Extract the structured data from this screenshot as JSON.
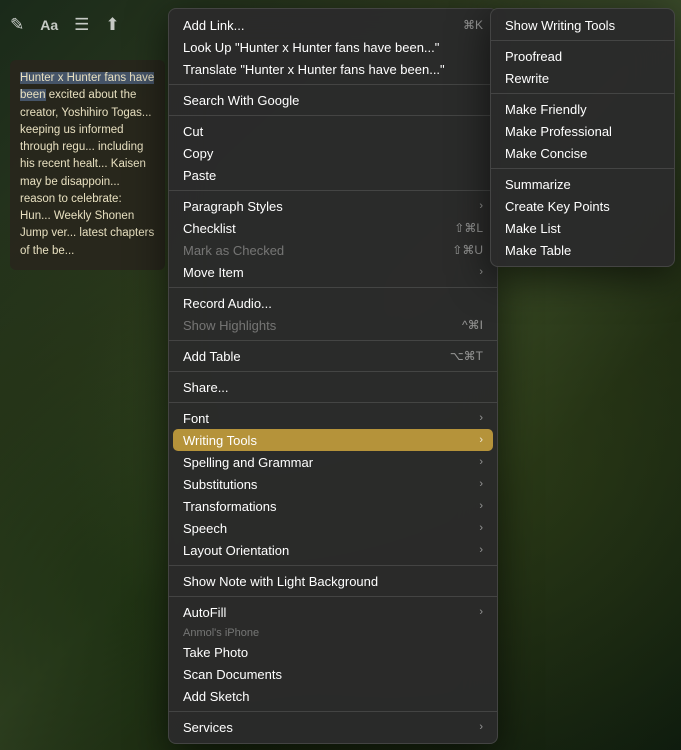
{
  "toolbar": {
    "icons": [
      "compose",
      "font",
      "list",
      "share"
    ]
  },
  "note": {
    "content": "Hunter x Hunter fans have been excited about the creator, Yoshihiro Togashi, keeping us informed through regular updates, including his recent health update. Kaisen may be disappoint... reason to celebrate: Hun... Weekly Shonen Jump ver... latest chapters of the be..."
  },
  "context_menu": {
    "items": [
      {
        "id": "add-link",
        "label": "Add Link...",
        "shortcut": "⌘K",
        "arrow": false,
        "disabled": false,
        "separator_after": false
      },
      {
        "id": "look-up",
        "label": "Look Up \"Hunter x Hunter fans have been...\"",
        "shortcut": "",
        "arrow": false,
        "disabled": false,
        "separator_after": false
      },
      {
        "id": "translate",
        "label": "Translate \"Hunter x Hunter fans have been...\"",
        "shortcut": "",
        "arrow": false,
        "disabled": false,
        "separator_after": true
      },
      {
        "id": "search-google",
        "label": "Search With Google",
        "shortcut": "",
        "arrow": false,
        "disabled": false,
        "separator_after": true
      },
      {
        "id": "cut",
        "label": "Cut",
        "shortcut": "",
        "arrow": false,
        "disabled": false,
        "separator_after": false
      },
      {
        "id": "copy",
        "label": "Copy",
        "shortcut": "",
        "arrow": false,
        "disabled": false,
        "separator_after": false
      },
      {
        "id": "paste",
        "label": "Paste",
        "shortcut": "",
        "arrow": false,
        "disabled": false,
        "separator_after": true
      },
      {
        "id": "paragraph-styles",
        "label": "Paragraph Styles",
        "shortcut": "",
        "arrow": true,
        "disabled": false,
        "separator_after": false
      },
      {
        "id": "checklist",
        "label": "Checklist",
        "shortcut": "⇧⌘L",
        "arrow": false,
        "disabled": false,
        "separator_after": false
      },
      {
        "id": "mark-as-checked",
        "label": "Mark as Checked",
        "shortcut": "⇧⌘U",
        "arrow": false,
        "disabled": true,
        "separator_after": false
      },
      {
        "id": "move-item",
        "label": "Move Item",
        "shortcut": "",
        "arrow": true,
        "disabled": false,
        "separator_after": true
      },
      {
        "id": "record-audio",
        "label": "Record Audio...",
        "shortcut": "",
        "arrow": false,
        "disabled": false,
        "separator_after": false
      },
      {
        "id": "show-highlights",
        "label": "Show Highlights",
        "shortcut": "^⌘I",
        "arrow": false,
        "disabled": true,
        "separator_after": true
      },
      {
        "id": "add-table",
        "label": "Add Table",
        "shortcut": "⌥⌘T",
        "arrow": false,
        "disabled": false,
        "separator_after": true
      },
      {
        "id": "share",
        "label": "Share...",
        "shortcut": "",
        "arrow": false,
        "disabled": false,
        "separator_after": true
      },
      {
        "id": "font",
        "label": "Font",
        "shortcut": "",
        "arrow": true,
        "disabled": false,
        "separator_after": false
      },
      {
        "id": "writing-tools",
        "label": "Writing Tools",
        "shortcut": "",
        "arrow": true,
        "disabled": false,
        "highlighted": true,
        "separator_after": false
      },
      {
        "id": "spelling-grammar",
        "label": "Spelling and Grammar",
        "shortcut": "",
        "arrow": true,
        "disabled": false,
        "separator_after": false
      },
      {
        "id": "substitutions",
        "label": "Substitutions",
        "shortcut": "",
        "arrow": true,
        "disabled": false,
        "separator_after": false
      },
      {
        "id": "transformations",
        "label": "Transformations",
        "shortcut": "",
        "arrow": true,
        "disabled": false,
        "separator_after": false
      },
      {
        "id": "speech",
        "label": "Speech",
        "shortcut": "",
        "arrow": true,
        "disabled": false,
        "separator_after": false
      },
      {
        "id": "layout-orientation",
        "label": "Layout Orientation",
        "shortcut": "",
        "arrow": true,
        "disabled": false,
        "separator_after": true
      },
      {
        "id": "show-note-light",
        "label": "Show Note with Light Background",
        "shortcut": "",
        "arrow": false,
        "disabled": false,
        "separator_after": true
      },
      {
        "id": "autofill",
        "label": "AutoFill",
        "shortcut": "",
        "arrow": true,
        "disabled": false,
        "separator_after": false
      },
      {
        "id": "section-iphone",
        "label": "Anmol's iPhone",
        "isSection": true,
        "separator_after": false
      },
      {
        "id": "take-photo",
        "label": "Take Photo",
        "shortcut": "",
        "arrow": false,
        "disabled": false,
        "separator_after": false
      },
      {
        "id": "scan-documents",
        "label": "Scan Documents",
        "shortcut": "",
        "arrow": false,
        "disabled": false,
        "separator_after": false
      },
      {
        "id": "add-sketch",
        "label": "Add Sketch",
        "shortcut": "",
        "arrow": false,
        "disabled": false,
        "separator_after": true
      },
      {
        "id": "services",
        "label": "Services",
        "shortcut": "",
        "arrow": true,
        "disabled": false,
        "separator_after": false
      }
    ]
  },
  "submenu": {
    "items": [
      {
        "id": "show-writing-tools",
        "label": "Show Writing Tools",
        "separator_after": true
      },
      {
        "id": "proofread",
        "label": "Proofread",
        "separator_after": false
      },
      {
        "id": "rewrite",
        "label": "Rewrite",
        "separator_after": true
      },
      {
        "id": "make-friendly",
        "label": "Make Friendly",
        "separator_after": false
      },
      {
        "id": "make-professional",
        "label": "Make Professional",
        "separator_after": false
      },
      {
        "id": "make-concise",
        "label": "Make Concise",
        "separator_after": true
      },
      {
        "id": "summarize",
        "label": "Summarize",
        "separator_after": false
      },
      {
        "id": "create-key-points",
        "label": "Create Key Points",
        "separator_after": false
      },
      {
        "id": "make-list",
        "label": "Make List",
        "separator_after": false
      },
      {
        "id": "make-table",
        "label": "Make Table",
        "separator_after": false
      }
    ]
  }
}
